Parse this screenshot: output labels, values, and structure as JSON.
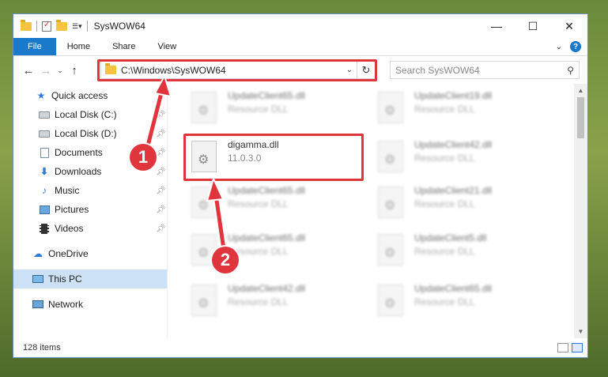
{
  "window": {
    "title": "SysWOW64",
    "controls": {
      "minimize": "—",
      "maximize": "☐",
      "close": "✕"
    }
  },
  "ribbon": {
    "tabs": [
      "File",
      "Home",
      "Share",
      "View"
    ],
    "expand_glyph": "⌄",
    "help_glyph": "?"
  },
  "address": {
    "path": "C:\\Windows\\SysWOW64",
    "search_placeholder": "Search SysWOW64"
  },
  "nav": {
    "back": "←",
    "forward": "→",
    "recent": "⌄",
    "up": "↑"
  },
  "sidebar": {
    "items": [
      {
        "label": "Quick access",
        "icon": "star-icon"
      },
      {
        "label": "Local Disk (C:)",
        "icon": "drive-icon",
        "pinned": true
      },
      {
        "label": "Local Disk (D:)",
        "icon": "drive-icon",
        "pinned": true
      },
      {
        "label": "Documents",
        "icon": "documents-icon",
        "pinned": true
      },
      {
        "label": "Downloads",
        "icon": "downloads-icon",
        "pinned": true
      },
      {
        "label": "Music",
        "icon": "music-icon",
        "pinned": true
      },
      {
        "label": "Pictures",
        "icon": "pictures-icon",
        "pinned": true
      },
      {
        "label": "Videos",
        "icon": "videos-icon",
        "pinned": true
      },
      {
        "label": "OneDrive",
        "icon": "cloud-icon"
      },
      {
        "label": "This PC",
        "icon": "computer-icon",
        "selected": true
      },
      {
        "label": "Network",
        "icon": "network-icon"
      }
    ]
  },
  "files": [
    {
      "name": "UpdateClient65.dll",
      "type": "Resource DLL",
      "blurred": true
    },
    {
      "name": "UpdateClient19.dll",
      "type": "Resource DLL",
      "blurred": true
    },
    {
      "name": "digamma.dll",
      "type": "11.0.3.0",
      "blurred": false
    },
    {
      "name": "UpdateClient42.dll",
      "type": "Resource DLL",
      "blurred": true
    },
    {
      "name": "UpdateClient65.dll",
      "type": "Resource DLL",
      "blurred": true
    },
    {
      "name": "UpdateClient21.dll",
      "type": "Resource DLL",
      "blurred": true
    },
    {
      "name": "UpdateClient65.dll",
      "type": "Resource DLL",
      "blurred": true
    },
    {
      "name": "UpdateClient5.dll",
      "type": "Resource DLL",
      "blurred": true
    },
    {
      "name": "UpdateClient42.dll",
      "type": "Resource DLL",
      "blurred": true
    },
    {
      "name": "UpdateClient65.dll",
      "type": "Resource DLL",
      "blurred": true
    }
  ],
  "status": {
    "item_count": "128 items"
  },
  "annotations": [
    {
      "number": "1"
    },
    {
      "number": "2"
    }
  ],
  "colors": {
    "accent": "#1979ca",
    "highlight": "#e0353d",
    "selection": "#cce1f5"
  }
}
